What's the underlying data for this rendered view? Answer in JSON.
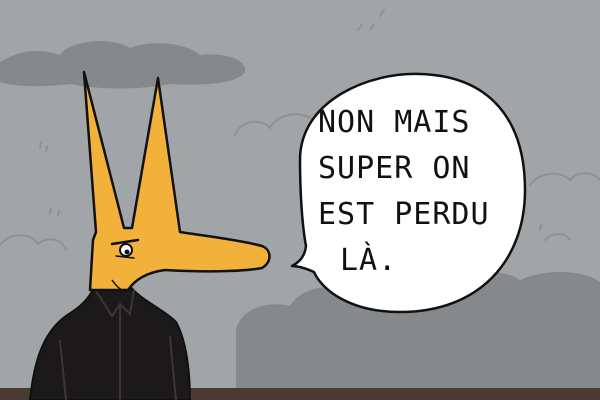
{
  "panel": {
    "speech_lines": [
      "NON MAIS",
      "SUPER ON",
      "EST PERDU",
      "LÀ."
    ]
  },
  "colors": {
    "sky": "#a2a5a7",
    "cloud_dark": "#86898b",
    "fox_fur": "#f2b13a",
    "jacket": "#1b1919",
    "ground": "#4a3a34",
    "bubble": "#ffffff",
    "ink": "#111111"
  }
}
